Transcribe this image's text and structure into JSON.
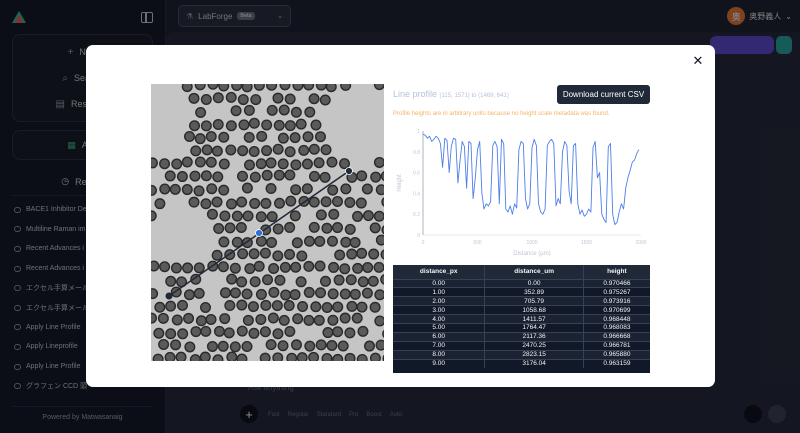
{
  "app": {
    "project_name": "LabForge",
    "project_badge": "Beta",
    "user_name": "奥野義人",
    "user_initial": "奥",
    "footer": "Powered by Matwasanaig"
  },
  "sidebar": {
    "actions": [
      {
        "label": "New",
        "icon": "plus-icon"
      },
      {
        "label": "Search",
        "icon": "search-icon"
      },
      {
        "label": "Research",
        "icon": "book-icon"
      }
    ],
    "add_label": "Add",
    "recent_label": "Recent",
    "items": [
      "BACE1 Inhibitor De",
      "Multiline Raman im",
      "Recent Advances i",
      "Recent Advances i",
      "エクセル手算メール",
      "エクセル手算メール",
      "Apply Line Profile",
      "Apply Lineprofile",
      "Apply Line Profile",
      "グラフェン CCD 頭"
    ]
  },
  "composer": {
    "placeholder": "Ask anything",
    "options": [
      "Fast",
      "Regular",
      "Standard",
      "Pro",
      "Boost",
      "Auto"
    ]
  },
  "modal": {
    "title": "Line profile",
    "title_coords": "(115, 1571) to (1469, 641)",
    "note": "Profile heights are in arbitrary units because no height scale metadata was found.",
    "download_label": "Download current CSV",
    "accent_color": "#4f7fe8",
    "table": {
      "headers": [
        "distance_px",
        "distance_um",
        "height"
      ],
      "rows": [
        [
          "0.00",
          "0.00",
          "0.970466"
        ],
        [
          "1.00",
          "352.89",
          "0.975267"
        ],
        [
          "2.00",
          "705.79",
          "0.973916"
        ],
        [
          "3.00",
          "1058.68",
          "0.970699"
        ],
        [
          "4.00",
          "1411.57",
          "0.968448"
        ],
        [
          "5.00",
          "1764.47",
          "0.968083"
        ],
        [
          "6.00",
          "2117.36",
          "0.966668"
        ],
        [
          "7.00",
          "2470.25",
          "0.966781"
        ],
        [
          "8.00",
          "2823.15",
          "0.965880"
        ],
        [
          "9.00",
          "3176.04",
          "0.963159"
        ]
      ]
    }
  },
  "chart_data": {
    "type": "line",
    "title": "Line profile",
    "xlabel": "Distance (µm)",
    "ylabel": "Height",
    "xlim": [
      0,
      2000
    ],
    "ylim": [
      0,
      1
    ],
    "x_ticks": [
      "0",
      "500",
      "1000",
      "1500",
      "2000"
    ],
    "y_ticks": [
      "0",
      "0.2",
      "0.4",
      "0.6",
      "0.8",
      "1"
    ],
    "grid": false,
    "series": [
      {
        "color": "#4f7fe8",
        "x": [
          0,
          20,
          40,
          60,
          80,
          100,
          120,
          140,
          160,
          180,
          200,
          220,
          240,
          260,
          280,
          300,
          320,
          340,
          360,
          380,
          400,
          420,
          440,
          460,
          480,
          500,
          520,
          540,
          560,
          580,
          600,
          620,
          640,
          660,
          680,
          700,
          720,
          740,
          760,
          780,
          800,
          820,
          840,
          860,
          880,
          900,
          920,
          940,
          960,
          980,
          1000,
          1020,
          1040,
          1060,
          1080,
          1100,
          1120,
          1140,
          1160,
          1180,
          1200,
          1220,
          1240,
          1260,
          1280,
          1300,
          1320,
          1340,
          1360,
          1380,
          1400,
          1420,
          1440,
          1460,
          1480,
          1500,
          1520,
          1540,
          1560,
          1580,
          1600,
          1620,
          1640,
          1660,
          1680,
          1700,
          1720,
          1740,
          1760,
          1780,
          1800,
          1820,
          1840,
          1860,
          1880,
          1900,
          1920,
          1940,
          1960,
          1980
        ],
        "y": [
          0.97,
          0.96,
          0.93,
          0.95,
          0.9,
          0.92,
          0.95,
          0.93,
          0.88,
          0.65,
          0.93,
          0.91,
          0.6,
          0.85,
          0.93,
          0.92,
          0.5,
          0.72,
          0.9,
          0.85,
          0.45,
          0.9,
          0.88,
          0.35,
          0.55,
          0.82,
          0.9,
          0.4,
          0.25,
          0.3,
          0.28,
          0.32,
          0.86,
          0.9,
          0.85,
          0.3,
          0.92,
          0.88,
          0.25,
          0.22,
          0.28,
          0.2,
          0.3,
          0.26,
          0.82,
          0.9,
          0.88,
          0.35,
          0.25,
          0.3,
          0.84,
          0.92,
          0.86,
          0.3,
          0.22,
          0.2,
          0.25,
          0.86,
          0.9,
          0.92,
          0.88,
          0.28,
          0.35,
          0.3,
          0.8,
          0.9,
          0.86,
          0.42,
          0.3,
          0.86,
          0.88,
          0.3,
          0.2,
          0.24,
          0.18,
          0.2,
          0.25,
          0.22,
          0.84,
          0.9,
          0.55,
          0.6,
          0.2,
          0.15,
          0.12,
          0.85,
          0.88,
          0.2,
          0.1,
          0.12,
          0.22,
          0.3,
          0.25,
          0.45,
          0.55,
          0.62,
          0.7,
          0.72,
          0.78,
          0.82
        ]
      }
    ]
  }
}
